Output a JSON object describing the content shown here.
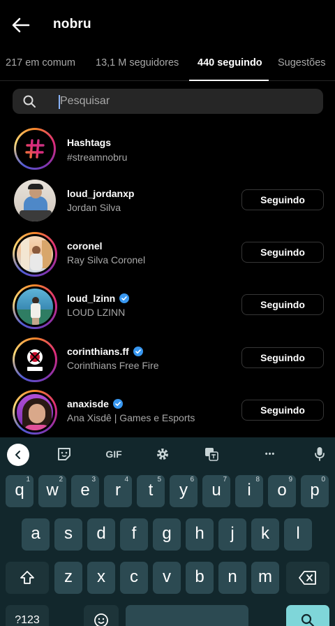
{
  "header": {
    "title": "nobru"
  },
  "tabs": [
    {
      "label": "217 em comum",
      "active": false
    },
    {
      "label": "13,1 M seguidores",
      "active": false
    },
    {
      "label": "440 seguindo",
      "active": true
    },
    {
      "label": "Sugestões",
      "active": false
    }
  ],
  "search": {
    "placeholder": "Pesquisar"
  },
  "hashtag_row": {
    "title": "Hashtags",
    "subtitle": "#streamnobru"
  },
  "accounts": [
    {
      "username": "loud_jordanxp",
      "fullname": "Jordan Silva",
      "verified": false,
      "button": "Seguindo"
    },
    {
      "username": "coronel",
      "fullname": "Ray Silva Coronel",
      "verified": false,
      "button": "Seguindo"
    },
    {
      "username": "loud_lzinn",
      "fullname": "LOUD LZINN",
      "verified": true,
      "button": "Seguindo"
    },
    {
      "username": "corinthians.ff",
      "fullname": "Corinthians Free Fire",
      "verified": true,
      "button": "Seguindo"
    },
    {
      "username": "anaxisde",
      "fullname": "Ana Xisdê | Games e Esports",
      "verified": true,
      "button": "Seguindo"
    }
  ],
  "keyboard": {
    "toolbar": {
      "gif_label": "GIF",
      "more_label": "•••"
    },
    "row1": [
      {
        "key": "q",
        "hint": "1"
      },
      {
        "key": "w",
        "hint": "2"
      },
      {
        "key": "e",
        "hint": "3"
      },
      {
        "key": "r",
        "hint": "4"
      },
      {
        "key": "t",
        "hint": "5"
      },
      {
        "key": "y",
        "hint": "6"
      },
      {
        "key": "u",
        "hint": "7"
      },
      {
        "key": "i",
        "hint": "8"
      },
      {
        "key": "o",
        "hint": "9"
      },
      {
        "key": "p",
        "hint": "0"
      }
    ],
    "row2": [
      "a",
      "s",
      "d",
      "f",
      "g",
      "h",
      "j",
      "k",
      "l"
    ],
    "row3": [
      "z",
      "x",
      "c",
      "v",
      "b",
      "n",
      "m"
    ],
    "symbols_label": "?123"
  },
  "colors": {
    "background": "#000000",
    "keyboard": "#12272c",
    "key": "#2c4a52",
    "accent": "#7fd6d9",
    "verified": "#3897f0"
  }
}
